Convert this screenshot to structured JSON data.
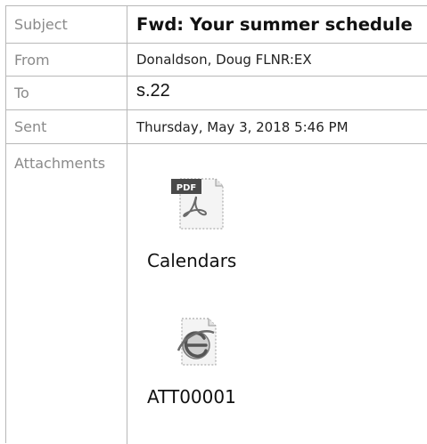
{
  "email": {
    "fields": {
      "subject": {
        "label": "Subject",
        "value": "Fwd: Your summer schedule"
      },
      "from": {
        "label": "From",
        "value": "Donaldson, Doug FLNR:EX"
      },
      "to": {
        "label": "To",
        "value": "s.22"
      },
      "sent": {
        "label": "Sent",
        "value": "Thursday, May 3, 2018 5:46 PM"
      },
      "attachments": {
        "label": "Attachments"
      }
    },
    "attachments": [
      {
        "name": "Calendars",
        "icon": "pdf-file-icon",
        "badge": "PDF"
      },
      {
        "name": "ATT00001",
        "icon": "html-file-icon"
      }
    ]
  }
}
